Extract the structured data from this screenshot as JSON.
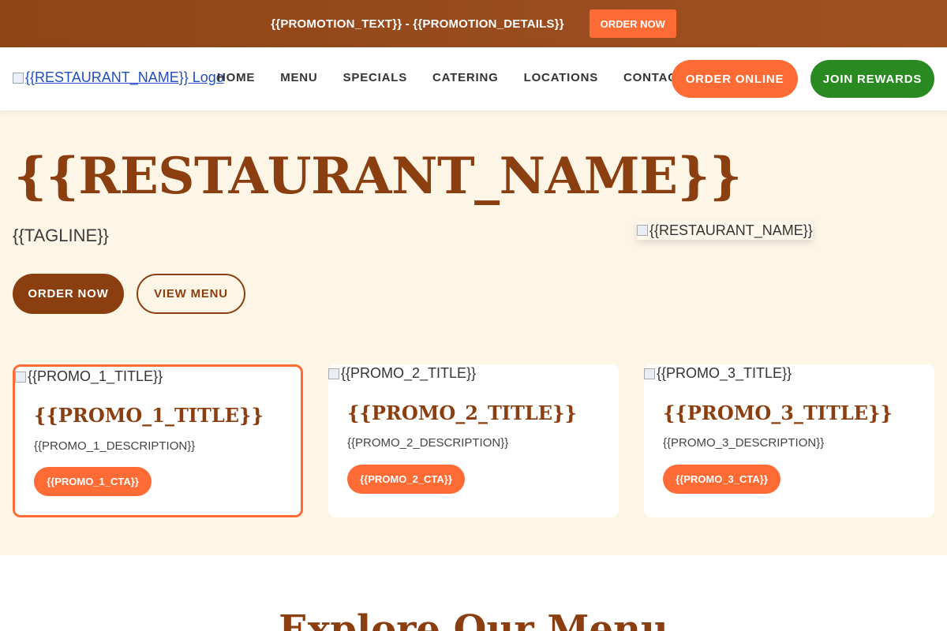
{
  "promo_bar": {
    "text": "{{PROMOTION_TEXT}} - {{PROMOTION_DETAILS}}",
    "button": "ORDER NOW"
  },
  "header": {
    "logo_alt": "{{RESTAURANT_NAME}} Logo",
    "nav": [
      "HOME",
      "MENU",
      "SPECIALS",
      "CATERING",
      "LOCATIONS",
      "CONTACT"
    ],
    "order_online": "ORDER ONLINE",
    "join_rewards": "JOIN REWARDS"
  },
  "hero": {
    "title": "{{RESTAURANT_NAME}}",
    "tagline": "{{TAGLINE}}",
    "order_button": "ORDER NOW",
    "menu_button": "VIEW MENU",
    "image_alt": "{{RESTAURANT_NAME}}"
  },
  "promos": [
    {
      "image_alt": "{{PROMO_1_TITLE}}",
      "title": "{{PROMO_1_TITLE}}",
      "description": "{{PROMO_1_DESCRIPTION}}",
      "cta": "{{PROMO_1_CTA}}"
    },
    {
      "image_alt": "{{PROMO_2_TITLE}}",
      "title": "{{PROMO_2_TITLE}}",
      "description": "{{PROMO_2_DESCRIPTION}}",
      "cta": "{{PROMO_2_CTA}}"
    },
    {
      "image_alt": "{{PROMO_3_TITLE}}",
      "title": "{{PROMO_3_TITLE}}",
      "description": "{{PROMO_3_DESCRIPTION}}",
      "cta": "{{PROMO_3_CTA}}"
    }
  ],
  "menu_section": {
    "heading": "Explore Our Menu"
  },
  "colors": {
    "brand_brown": "#8b3e10",
    "accent_orange": "#ff6b35",
    "rewards_green": "#2a8a22",
    "hero_bg": "#fdf6e7"
  }
}
